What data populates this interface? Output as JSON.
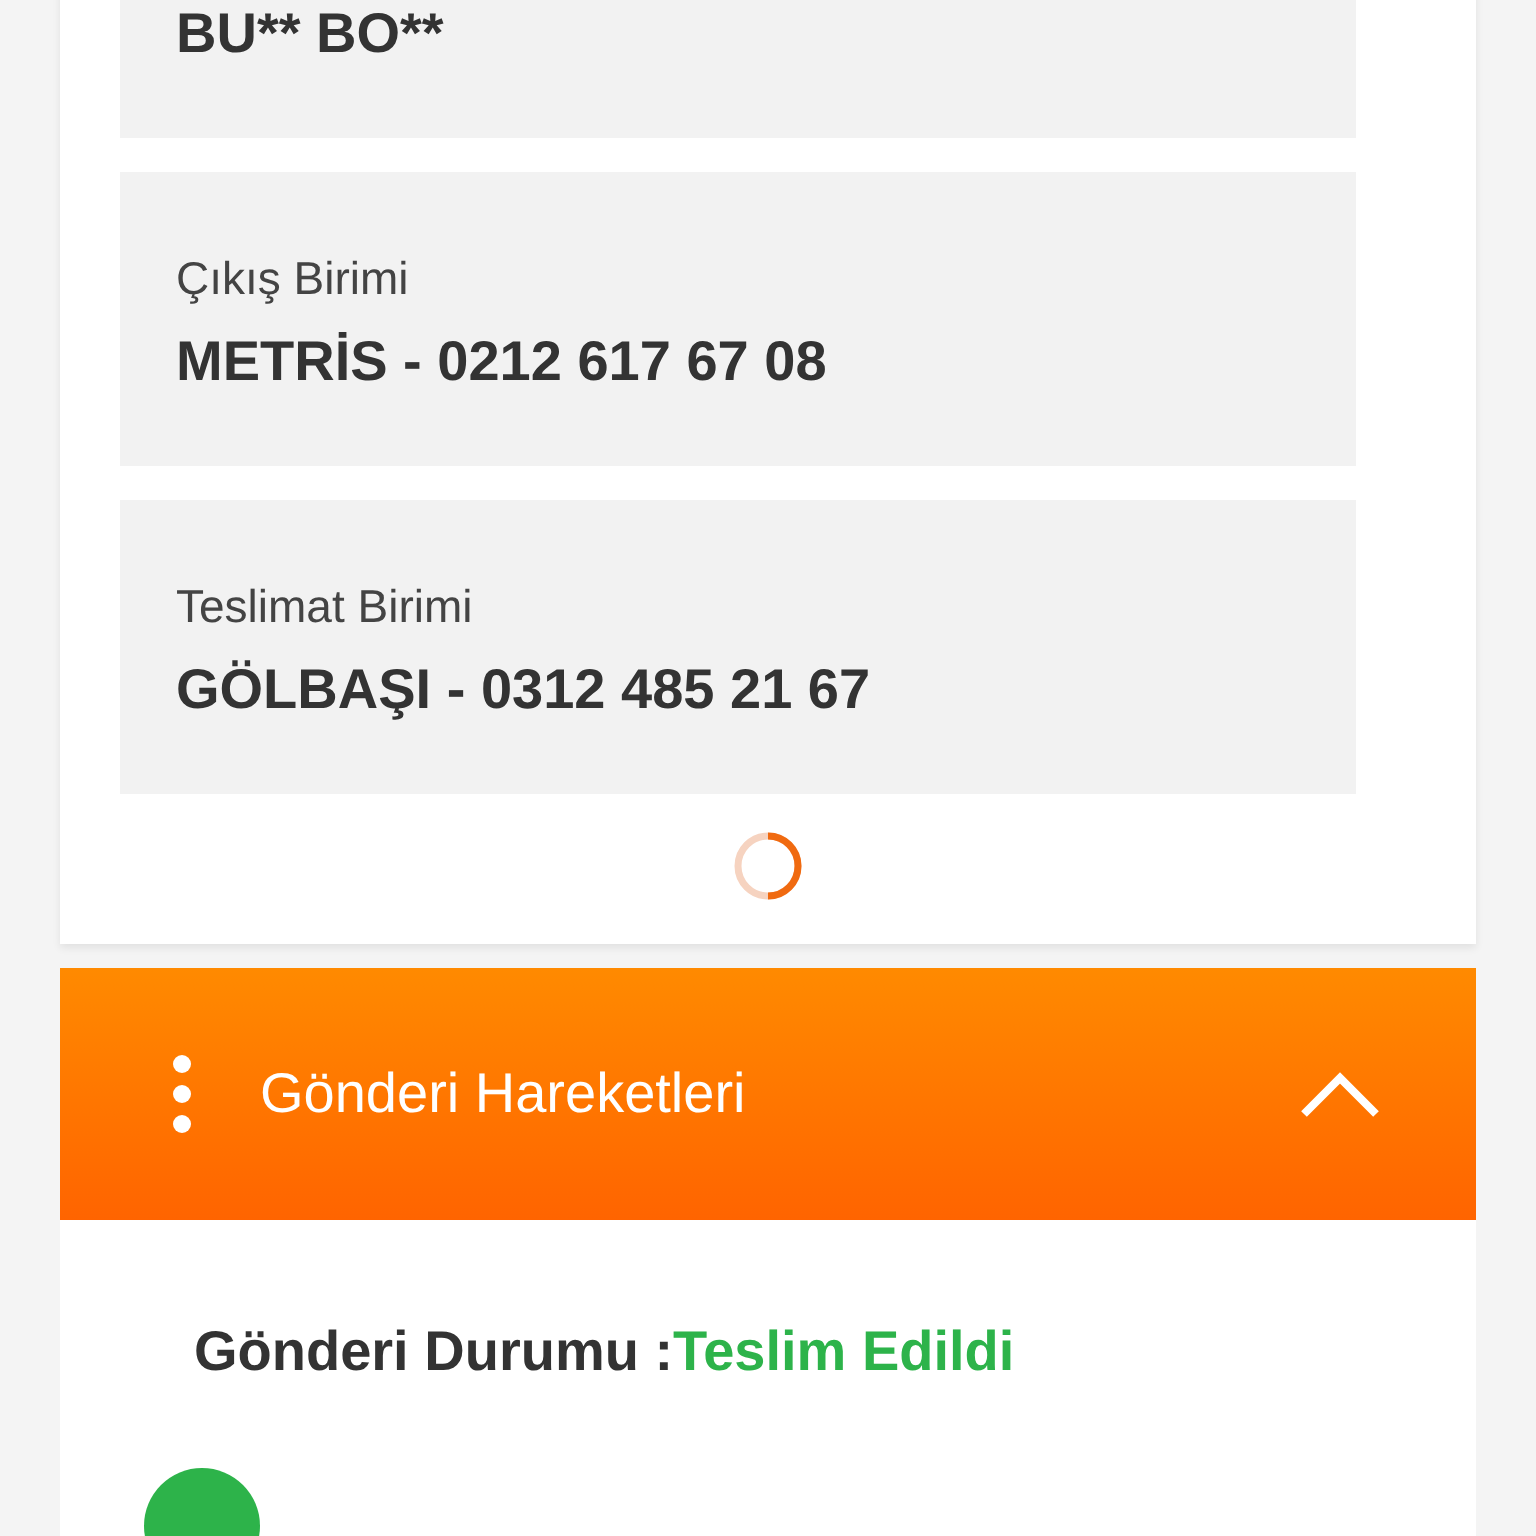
{
  "details": [
    {
      "value": "BU** BO**"
    },
    {
      "label": "Çıkış Birimi",
      "value": "METRİS - 0212 617 67 08"
    },
    {
      "label": "Teslimat Birimi",
      "value": "GÖLBAŞI - 0312 485 21 67"
    }
  ],
  "movements": {
    "title": "Gönderi Hareketleri",
    "expanded": true,
    "status_label": "Gönderi Durumu :",
    "status_value": "Teslim Edildi"
  }
}
